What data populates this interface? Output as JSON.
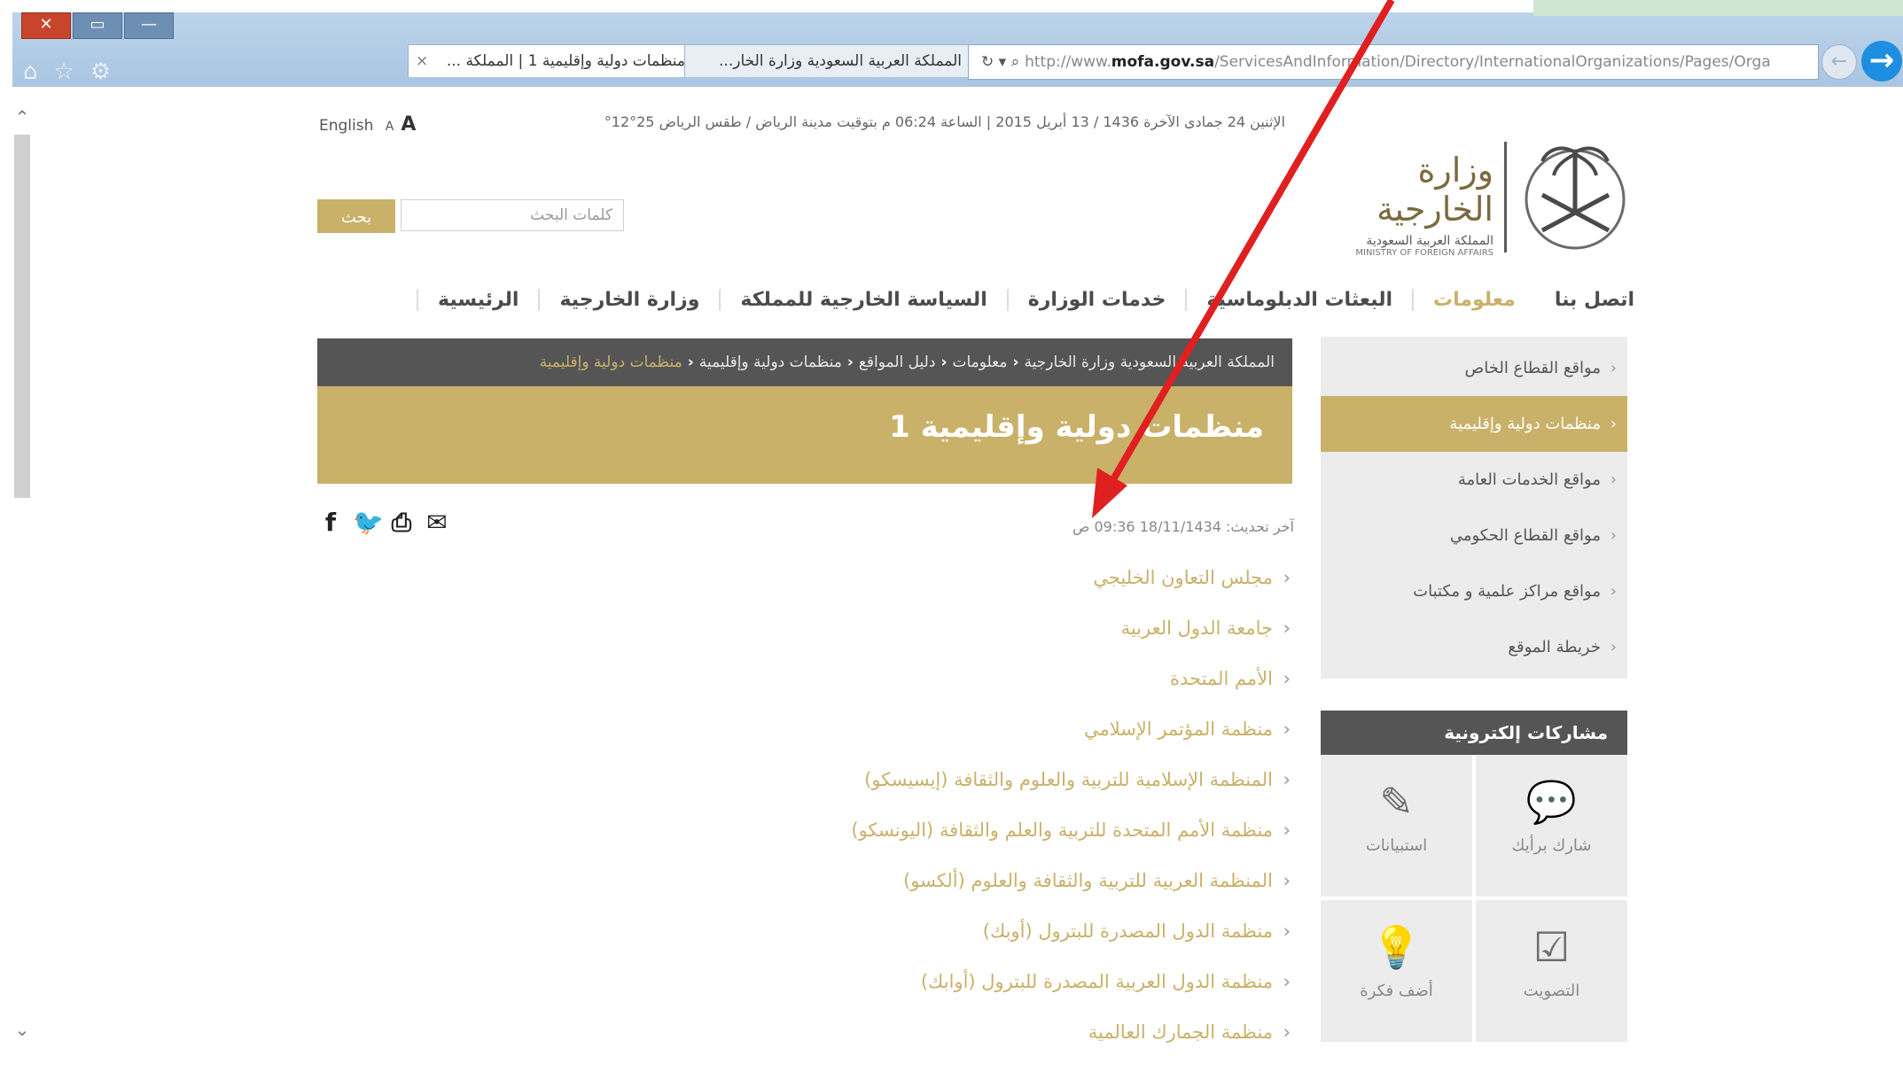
{
  "browser": {
    "tabs": [
      {
        "label": "منظمات دولية وإقليمية 1 | المملكة ...",
        "active": true
      },
      {
        "label": "المملكة العربية السعودية وزارة الخار...",
        "active": false
      }
    ],
    "url_prefix": "http://www.",
    "url_domain": "mofa.gov.sa",
    "url_path": "/ServicesAndInformation/Directory/InternationalOrganizations/Pages/Orga"
  },
  "topbar": {
    "text": "الإثنين 24 جمادى الآخرة 1436 / 13 أبريل 2015 | الساعة 06:24 م بتوقيت مدينة الرياض / طقس الرياض 25°12°",
    "lang": "English"
  },
  "logo": {
    "title": "وزارة الخارجية",
    "subtitle": "المملكة العربية السعودية",
    "english": "MINISTRY OF FOREIGN AFFAIRS"
  },
  "search": {
    "placeholder": "كلمات البحث",
    "button": "بحث"
  },
  "nav": [
    {
      "label": "الرئيسية",
      "active": false
    },
    {
      "label": "وزارة الخارجية",
      "active": false
    },
    {
      "label": "السياسة الخارجية للمملكة",
      "active": false
    },
    {
      "label": "خدمات الوزارة",
      "active": false
    },
    {
      "label": "البعثات الدبلوماسية",
      "active": false
    },
    {
      "label": "معلومات",
      "active": true
    },
    {
      "label": "اتصل بنا",
      "active": false
    }
  ],
  "sidebar": {
    "items": [
      {
        "label": "مواقع القطاع الخاص",
        "active": false
      },
      {
        "label": "منظمات دولية وإقليمية",
        "active": true
      },
      {
        "label": "مواقع الخدمات العامة",
        "active": false
      },
      {
        "label": "مواقع القطاع الحكومي",
        "active": false
      },
      {
        "label": "مواقع مراكز علمية و مكتبات",
        "active": false
      },
      {
        "label": "خريطة الموقع",
        "active": false
      }
    ],
    "eparticipation_title": "مشاركات إلكترونية",
    "tiles": [
      {
        "label": "استبيانات",
        "icon": "survey-icon",
        "glyph": "✎"
      },
      {
        "label": "شارك برأيك",
        "icon": "comment-icon",
        "glyph": "💬"
      },
      {
        "label": "أضف فكرة",
        "icon": "lightbulb-icon",
        "glyph": "💡"
      },
      {
        "label": "التصويت",
        "icon": "vote-checkbox-icon",
        "glyph": "☑"
      }
    ]
  },
  "breadcrumb": {
    "items": [
      "المملكة العربية السعودية وزارة الخارجية",
      "معلومات",
      "دليل المواقع",
      "منظمات دولية وإقليمية"
    ],
    "current": "منظمات دولية وإقليمية"
  },
  "page": {
    "title": "منظمات دولية وإقليمية 1",
    "updated": "آخر تحديث: 18/11/1434 09:36 ص"
  },
  "organizations": [
    "مجلس التعاون الخليجي",
    "جامعة الدول العربية",
    "الأمم المتحدة",
    "منظمة المؤتمر الإسلامي",
    "المنظمة الإسلامية للتربية والعلوم والثقافة (إيسيسكو)",
    "منظمة الأمم المتحدة للتربية والعلم والثقافة (اليونسكو)",
    "المنظمة العربية للتربية والثقافة والعلوم (ألكسو)",
    "منظمة الدول المصدرة للبترول (أوبك)",
    "منظمة الدول العربية المصدرة للبترول (أوابك)",
    "منظمة الجمارك العالمية"
  ],
  "colors": {
    "accent": "#c9b16a",
    "dark": "#555555",
    "annotation": "#e02020"
  }
}
